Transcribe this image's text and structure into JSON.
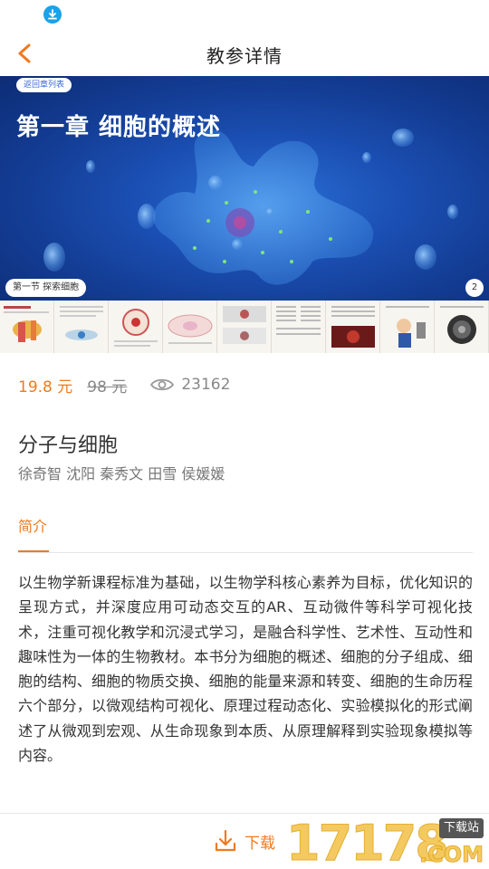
{
  "nav": {
    "title": "教参详情"
  },
  "banner": {
    "return_label": "返回章列表",
    "chapter_title": "第一章 细胞的概述",
    "section_label": "第一节 探索细胞",
    "page_number": "2"
  },
  "pricing": {
    "current": "19.8 元",
    "original": "98 元",
    "views": "23162"
  },
  "book": {
    "title": "分子与细胞",
    "authors": "徐奇智 沈阳 秦秀文 田雪 侯媛媛"
  },
  "tabs": {
    "intro_label": "简介"
  },
  "intro": {
    "text": "以生物学新课程标准为基础，以生物学科核心素养为目标，优化知识的呈现方式，并深度应用可动态交互的AR、互动微件等科学可视化技术，注重可视化教学和沉浸式学习，是融合科学性、艺术性、互动性和趣味性为一体的生物教材。本书分为细胞的概述、细胞的分子组成、细胞的结构、细胞的物质交换、细胞的能量来源和转变、细胞的生命历程六个部分，以微观结构可视化、原理过程动态化、实验模拟化的形式阐述了从微观到宏观、从生命现象到本质、从原理解释到实验现象模拟等内容。"
  },
  "bottom": {
    "download_label": "下载"
  },
  "watermark": {
    "digits": "17178",
    "tag": "下载站",
    "suffix": ".COM"
  },
  "colors": {
    "accent": "#f07a1e",
    "status_icon": "#19a3e8",
    "banner_blue": "#1b4fb3"
  },
  "icons": {
    "status": "download-icon",
    "back": "chevron-left-icon",
    "views": "eye-icon",
    "download": "download-icon"
  }
}
